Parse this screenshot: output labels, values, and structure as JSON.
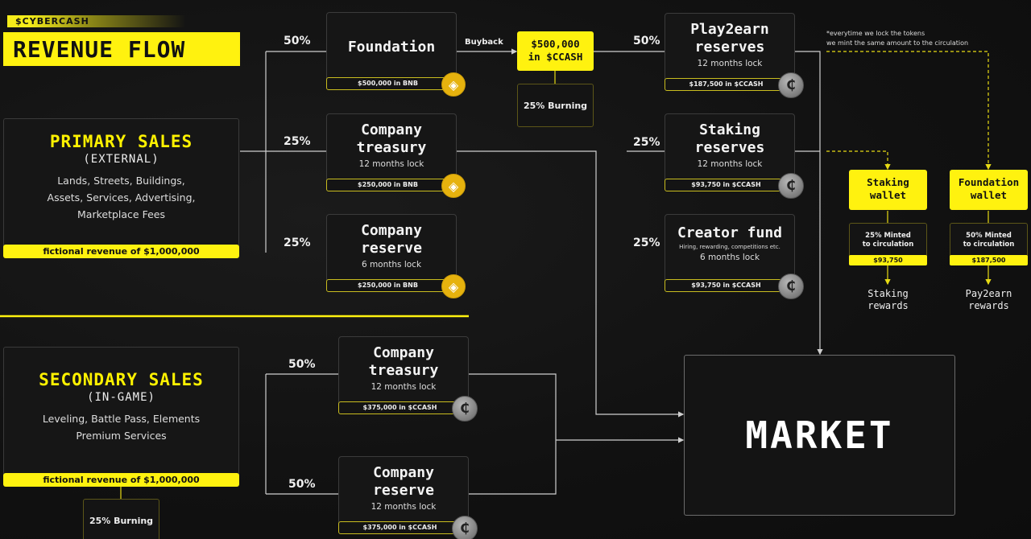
{
  "header": {
    "brand": "$CYBERCASH",
    "title": "REVENUE FLOW"
  },
  "colors": {
    "accent_yellow": "#fff20f",
    "background": "#121212",
    "bnb_gold": "#e6b20e",
    "line_gray": "#cfcfcf"
  },
  "primary_sales": {
    "title": "PRIMARY SALES",
    "subtitle": "(EXTERNAL)",
    "desc_line1": "Lands, Streets, Buildings,",
    "desc_line2": "Assets, Services, Advertising,",
    "desc_line3": "Marketplace Fees",
    "revenue": "fictional revenue of $1,000,000"
  },
  "secondary_sales": {
    "title": "SECONDARY SALES",
    "subtitle": "(IN-GAME)",
    "desc_line1": "Leveling, Battle Pass, Elements",
    "desc_line2": "Premium Services",
    "revenue": "fictional revenue of $1,000,000",
    "burning": "25% Burning"
  },
  "primary_split": {
    "foundation": {
      "pct": "50%",
      "title": "Foundation",
      "amount": "$500,000 in BNB",
      "coin": "bnb-icon"
    },
    "company_treasury": {
      "pct": "25%",
      "title_line1": "Company",
      "title_line2": "treasury",
      "lock": "12 months lock",
      "amount": "$250,000 in BNB",
      "coin": "bnb-icon"
    },
    "company_reserve": {
      "pct": "25%",
      "title_line1": "Company",
      "title_line2": "reserve",
      "lock": "6 months lock",
      "amount": "$250,000 in BNB",
      "coin": "bnb-icon"
    }
  },
  "buyback": {
    "label": "Buyback",
    "amount_line1": "$500,000",
    "amount_line2": "in $CCASH",
    "burning": "25% Burning"
  },
  "ccash_split": {
    "play2earn": {
      "pct": "50%",
      "title_line1": "Play2earn",
      "title_line2": "reserves",
      "lock": "12 months lock",
      "amount": "$187,500 in $CCASH",
      "coin": "ccash-icon"
    },
    "staking": {
      "pct": "25%",
      "title_line1": "Staking",
      "title_line2": "reserves",
      "lock": "12 months lock",
      "amount": "$93,750 in $CCASH",
      "coin": "ccash-icon"
    },
    "creator_fund": {
      "pct": "25%",
      "title": "Creator fund",
      "note": "Hiring, rewarding, competitions etc.",
      "lock": "6 months lock",
      "amount": "$93,750 in $CCASH",
      "coin": "ccash-icon"
    }
  },
  "footnote": {
    "line1": "*everytime we lock the tokens",
    "line2": "we mint the same amount to the circulation"
  },
  "wallets": {
    "staking": {
      "title_line1": "Staking",
      "title_line2": "wallet",
      "mint_line1": "25% Minted",
      "mint_line2": "to circulation",
      "amount": "$93,750",
      "reward_line1": "Staking",
      "reward_line2": "rewards"
    },
    "foundation": {
      "title_line1": "Foundation",
      "title_line2": "wallet",
      "mint_line1": "50% Minted",
      "mint_line2": "to circulation",
      "amount": "$187,500",
      "reward_line1": "Pay2earn",
      "reward_line2": "rewards"
    }
  },
  "secondary_split": {
    "company_treasury": {
      "pct": "50%",
      "title_line1": "Company",
      "title_line2": "treasury",
      "lock": "12 months lock",
      "amount": "$375,000 in $CCASH",
      "coin": "ccash-icon"
    },
    "company_reserve": {
      "pct": "50%",
      "title_line1": "Company",
      "title_line2": "reserve",
      "lock": "12 months lock",
      "amount": "$375,000 in $CCASH",
      "coin": "ccash-icon"
    }
  },
  "market": {
    "label": "MARKET"
  },
  "icons": {
    "bnb_glyph": "◈",
    "ccash_glyph": "₵"
  }
}
